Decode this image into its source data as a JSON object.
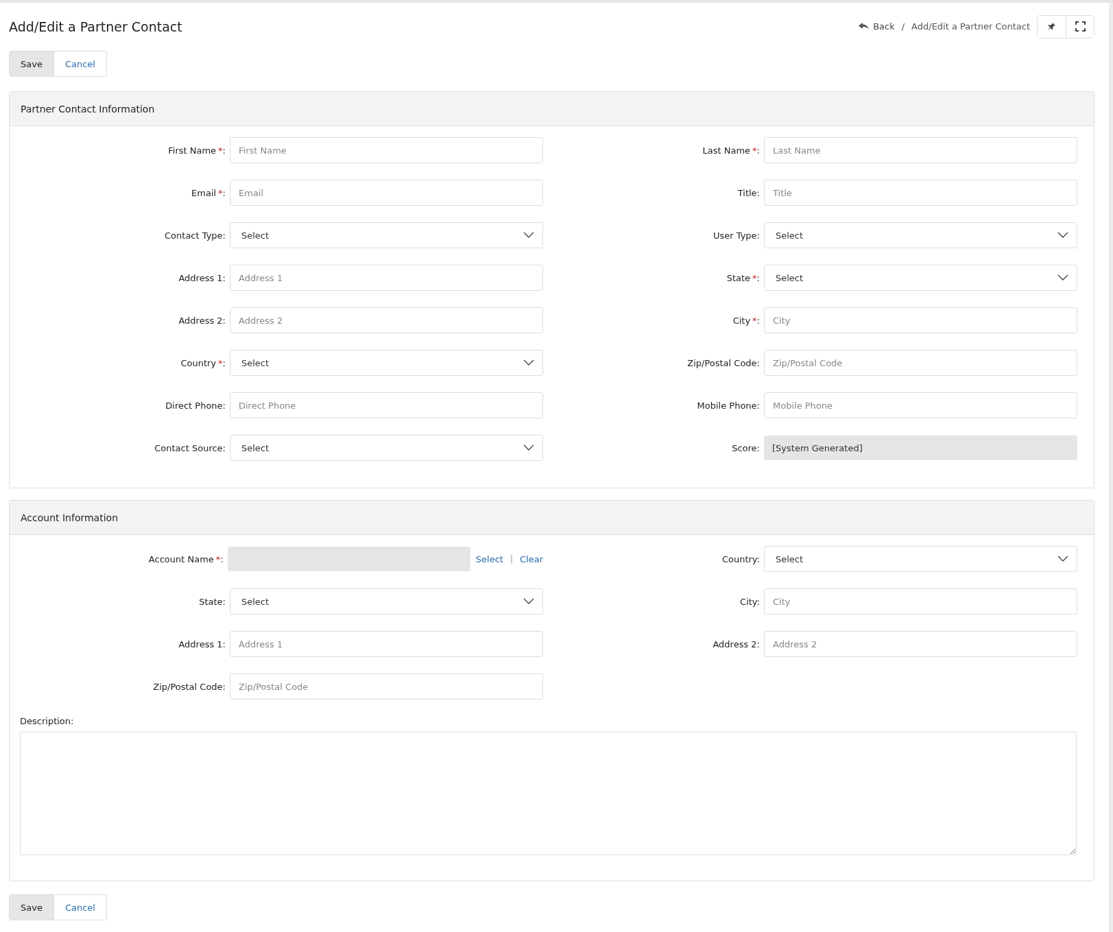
{
  "page_title": "Add/Edit a Partner Contact",
  "breadcrumb": {
    "back": "Back",
    "separator": "/",
    "current": "Add/Edit a Partner Contact"
  },
  "header_tools": [
    {
      "kind": "pin"
    },
    {
      "kind": "expand"
    }
  ],
  "top_actions": [
    {
      "label": "Save",
      "kind": "primary"
    },
    {
      "label": "Cancel",
      "kind": "link"
    }
  ],
  "sections": [
    {
      "title": "Partner Contact Information",
      "fields": [
        {
          "label": "First Name",
          "required_mark": "*",
          "colon": ":",
          "kind": "text",
          "placeholder": "First Name"
        },
        {
          "label": "Last Name",
          "required_mark": "*",
          "colon": ":",
          "kind": "text",
          "placeholder": "Last Name"
        },
        {
          "label": "Email",
          "required_mark": "*",
          "colon": ":",
          "kind": "text",
          "placeholder": "Email"
        },
        {
          "label": "Title",
          "colon": ":",
          "kind": "text",
          "placeholder": "Title"
        },
        {
          "label": "Contact Type",
          "colon": ":",
          "kind": "select",
          "value": "Select"
        },
        {
          "label": "User Type",
          "colon": ":",
          "kind": "select",
          "value": "Select"
        },
        {
          "label": "Address 1",
          "colon": ":",
          "kind": "text",
          "placeholder": "Address 1"
        },
        {
          "label": "State",
          "required_mark": "*",
          "colon": ":",
          "kind": "select",
          "value": "Select"
        },
        {
          "label": "Address 2",
          "colon": ":",
          "kind": "text",
          "placeholder": "Address 2"
        },
        {
          "label": "City",
          "required_mark": "*",
          "colon": ":",
          "kind": "text",
          "placeholder": "City"
        },
        {
          "label": "Country",
          "required_mark": "*",
          "colon": ":",
          "kind": "select",
          "value": "Select"
        },
        {
          "label": "Zip/Postal Code",
          "colon": ":",
          "kind": "text",
          "placeholder": "Zip/Postal Code"
        },
        {
          "label": "Direct Phone",
          "colon": ":",
          "kind": "text",
          "placeholder": "Direct Phone"
        },
        {
          "label": "Mobile Phone",
          "colon": ":",
          "kind": "text",
          "placeholder": "Mobile Phone"
        },
        {
          "label": "Contact Source",
          "colon": ":",
          "kind": "select",
          "value": "Select"
        },
        {
          "label": "Score",
          "colon": ":",
          "kind": "readonly",
          "value": "[System Generated]"
        }
      ]
    },
    {
      "title": "Account Information",
      "fields": [
        {
          "label": "Account Name",
          "required_mark": "*",
          "colon": ":",
          "kind": "lookup",
          "links": [
            "Select",
            "Clear"
          ],
          "separator": "|"
        },
        {
          "label": "Country",
          "colon": ":",
          "kind": "select",
          "value": "Select"
        },
        {
          "label": "State",
          "colon": ":",
          "kind": "select",
          "value": "Select"
        },
        {
          "label": "City",
          "colon": ":",
          "kind": "text",
          "placeholder": "City"
        },
        {
          "label": "Address 1",
          "colon": ":",
          "kind": "text",
          "placeholder": "Address 1"
        },
        {
          "label": "Address 2",
          "colon": ":",
          "kind": "text",
          "placeholder": "Address 2"
        },
        {
          "label": "Zip/Postal Code",
          "colon": ":",
          "kind": "text",
          "placeholder": "Zip/Postal Code"
        }
      ],
      "description": {
        "label": "Description:"
      }
    }
  ],
  "bottom_actions": [
    {
      "label": "Save",
      "kind": "primary"
    },
    {
      "label": "Cancel",
      "kind": "link"
    }
  ]
}
